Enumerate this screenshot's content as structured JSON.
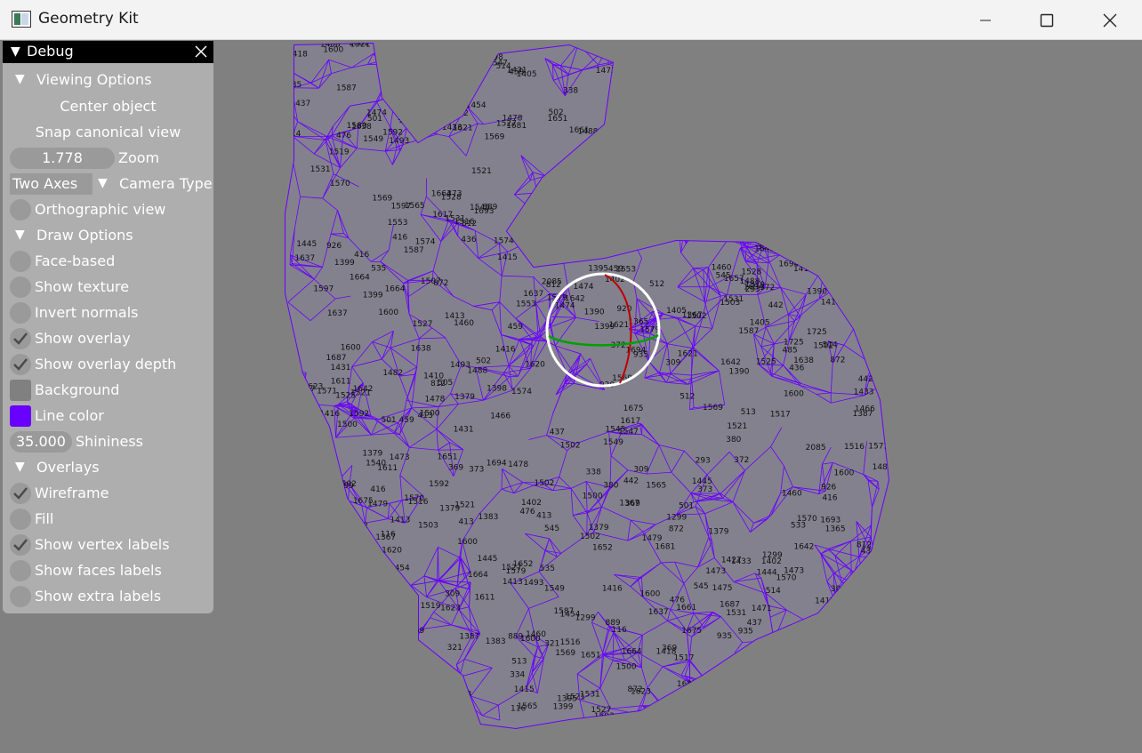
{
  "window": {
    "title": "Geometry Kit"
  },
  "panel": {
    "title": "Debug",
    "viewing": {
      "header": "Viewing Options",
      "center_label": "Center object",
      "snap_label": "Snap canonical view",
      "zoom_value": "1.778",
      "zoom_label": "Zoom",
      "camera_value": "Two Axes",
      "camera_label": "Camera Type",
      "ortho_label": "Orthographic view",
      "ortho_checked": false
    },
    "draw": {
      "header": "Draw Options",
      "face_label": "Face-based",
      "face_checked": false,
      "texture_label": "Show texture",
      "texture_checked": false,
      "invert_label": "Invert normals",
      "invert_checked": false,
      "overlay_label": "Show overlay",
      "overlay_checked": true,
      "overlay_depth_label": "Show overlay depth",
      "overlay_depth_checked": true,
      "background_label": "Background",
      "background_color": "#808080",
      "line_color_label": "Line color",
      "line_color": "#6a00ff",
      "shininess_value": "35.000",
      "shininess_label": "Shininess"
    },
    "overlays": {
      "header": "Overlays",
      "wireframe_label": "Wireframe",
      "wireframe_checked": true,
      "fill_label": "Fill",
      "fill_checked": false,
      "vertex_labels_label": "Show vertex labels",
      "vertex_labels_checked": true,
      "faces_labels_label": "Show faces labels",
      "faces_labels_checked": false,
      "extra_labels_label": "Show extra labels",
      "extra_labels_checked": false
    }
  },
  "viewport": {
    "mesh_color": "#6a00ff",
    "vertex_label_samples": [
      "1642",
      "1299",
      "1725",
      "1664",
      "485",
      "1540",
      "1657",
      "1661",
      "889",
      "926",
      "812",
      "1527",
      "1623",
      "1637",
      "1600",
      "1531",
      "1687",
      "1570",
      "1521",
      "1466",
      "338",
      "373",
      "512",
      "505",
      "1553",
      "1379",
      "1621",
      "1694",
      "1482",
      "1367",
      "1365",
      "1387",
      "513",
      "514",
      "545",
      "1418",
      "416",
      "413",
      "1569",
      "372",
      "380",
      "334",
      "369",
      "459",
      "442",
      "1478",
      "1379",
      "1547",
      "1405",
      "1528",
      "1454",
      "1431",
      "1502",
      "1444",
      "1402",
      "1519",
      "1651",
      "1592",
      "1600",
      "1638",
      "1617",
      "1521",
      "1525",
      "1507",
      "1611",
      "1620",
      "1579",
      "1445",
      "1474",
      "1664",
      "1489",
      "1587",
      "1681",
      "1415",
      "1479",
      "2085",
      "1693",
      "293",
      "437",
      "116",
      "935",
      "920",
      "872",
      "437",
      "1516",
      "1675",
      "1493",
      "1549",
      "1652",
      "1571",
      "1413",
      "1517",
      "1545",
      "1597",
      "535",
      "533",
      "476",
      "436",
      "1502",
      "1410",
      "309",
      "502",
      "1460",
      "501",
      "321",
      "1433",
      "1427",
      "1383",
      "1416",
      "1398",
      "1500",
      "1471",
      "1473",
      "1475",
      "1488",
      "1500",
      "1503",
      "1565",
      "1569",
      "1574",
      "1580",
      "1390",
      "1399",
      "1395"
    ],
    "gizmo": {
      "ring_color": "#ffffff",
      "x_axis_color": "#c00000",
      "z_axis_color": "#00a000"
    }
  }
}
